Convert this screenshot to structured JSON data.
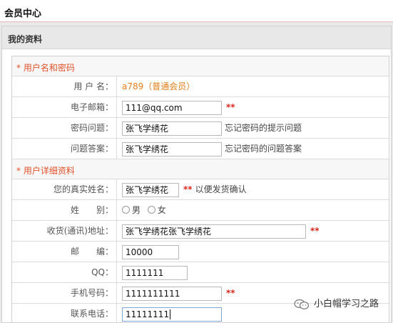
{
  "header": {
    "title": "会员中心"
  },
  "panel": {
    "title": "我的资料"
  },
  "sections": {
    "account": {
      "title": "* 用户名和密码"
    },
    "detail": {
      "title": "* 用户详细资料"
    }
  },
  "fields": {
    "username": {
      "label": "用 户 名：",
      "value": "a789（普通会员）"
    },
    "email": {
      "label": "电子邮箱：",
      "value": "111@qq.com",
      "required": "**"
    },
    "question": {
      "label": "密码问题：",
      "value": "张飞学绣花",
      "hint": "忘记密码的提示问题"
    },
    "answer": {
      "label": "问题答案：",
      "value": "张飞学绣花",
      "hint": "忘记密码的问题答案"
    },
    "realname": {
      "label": "您的真实姓名：",
      "value": "张飞学绣花",
      "required": "**",
      "hint": "以便发货确认"
    },
    "gender": {
      "label": "姓　　别：",
      "options": [
        "男",
        "女"
      ]
    },
    "address": {
      "label": "收货(通讯)地址：",
      "value": "张飞学绣花张飞学绣花",
      "required": "**"
    },
    "zipcode": {
      "label": "邮　　编：",
      "value": "10000"
    },
    "qq": {
      "label": "QQ：",
      "value": "1111111"
    },
    "mobile": {
      "label": "手机号码：",
      "value": "1111111111",
      "required": "**"
    },
    "phone": {
      "label": "联系电话：",
      "value": "11111111"
    }
  },
  "watermark": {
    "text": "小白帽学习之路",
    "icon": "wechat-icon"
  }
}
